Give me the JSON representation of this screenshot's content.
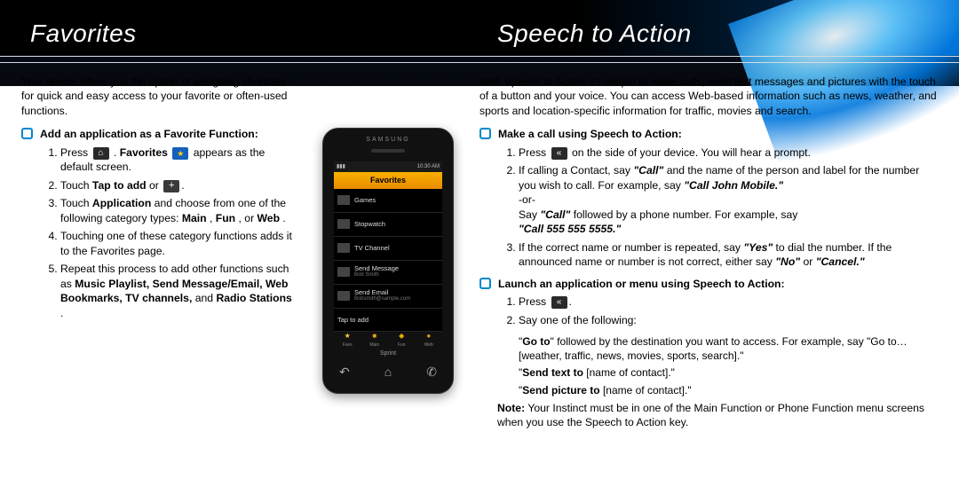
{
  "titles": {
    "left": "Favorites",
    "right": "Speech to Action"
  },
  "left": {
    "intro": "Your device offers you the option of assigning shortcuts for quick and easy access to your favorite or often-used functions.",
    "section": "Add an application as a Favorite Function:",
    "steps": {
      "s1a": "Press ",
      "s1b": ". ",
      "s1c": "Favorites",
      "s1d": " appears as the default screen.",
      "s2a": "Touch ",
      "s2b": "Tap to add",
      "s2c": " or ",
      "s3a": "Touch ",
      "s3b": "Application",
      "s3c": " and choose from one of the following category types: ",
      "s3d": "Main",
      "s3e": ", ",
      "s3f": "Fun",
      "s3g": ", or ",
      "s3h": "Web",
      "s3i": ".",
      "s4": "Touching one of these category functions adds it to the Favorites page.",
      "s5a": "Repeat this process to add other functions such as ",
      "s5b": "Music Playlist, Send Message/Email, Web Bookmarks, TV channels,",
      "s5c": " and ",
      "s5d": "Radio Stations",
      "s5e": "."
    }
  },
  "right": {
    "intro": "With Speech to Action it's simple to make calls, send text messages and pictures with the touch of a button and your voice. You can access Web-based information such as news, weather, and sports and location-specific information for traffic, movies and search.",
    "sect1": "Make a call using Speech to Action:",
    "m1a": "Press ",
    "m1b": " on the side of your device. You will hear a prompt.",
    "m2a": "If calling a Contact, say ",
    "m2b": "\"Call\"",
    "m2c": " and the name of the person and label for the number you wish to call. For example, say ",
    "m2d": "\"Call John Mobile.\"",
    "m2or": "-or-",
    "m2e": "Say ",
    "m2f": "\"Call\"",
    "m2g": " followed by  a phone number. For example, say ",
    "m2h": "\"Call 555 555 5555.\"",
    "m3a": "If the correct name or number is repeated, say ",
    "m3b": "\"Yes\"",
    "m3c": " to dial the number. If the announced name or number is not correct, either say ",
    "m3d": "\"No\"",
    "m3e": " or ",
    "m3f": "\"Cancel.\"",
    "sect2": "Launch an application or menu using Speech to Action:",
    "l1": "Press ",
    "l2": "Say one of the following:",
    "sub": {
      "goto1": "\"",
      "goto2": "Go to",
      "goto3": "\" followed by the destination you want to access. For example, say \"Go to…[weather, traffic, news, movies, sports, search].\"",
      "st1": "\"",
      "st2": "Send text to",
      "st3": " [name of contact].\"",
      "sp1": "\"",
      "sp2": "Send picture to",
      "sp3": " [name of contact].\""
    },
    "noteLabel": "Note:",
    "note": " Your Instinct must be in one of the Main Function or Phone Function menu screens when you use the Speech to Action key."
  },
  "phone": {
    "brand": "SAMSUNG",
    "time": "10:30 AM",
    "header": "Favorites",
    "rows": [
      {
        "label": "Games",
        "sub": ""
      },
      {
        "label": "Stopwatch",
        "sub": ""
      },
      {
        "label": "TV Channel",
        "sub": ""
      },
      {
        "label": "Send Message",
        "sub": "Bob Smith"
      },
      {
        "label": "Send Email",
        "sub": "Bsbsmith@sample.com"
      },
      {
        "label": "Tap to add",
        "sub": ""
      }
    ],
    "tabs": [
      "Favs",
      "Main",
      "Fun",
      "Web"
    ],
    "carrier": "Sprint"
  }
}
